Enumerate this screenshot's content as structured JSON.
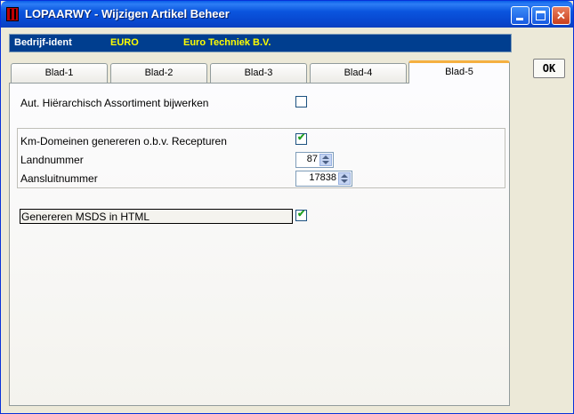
{
  "window": {
    "title": "LOPAARWY - Wijzigen Artikel Beheer"
  },
  "infobar": {
    "label": "Bedrijf-ident",
    "code": "EURO",
    "company": "Euro Techniek B.V."
  },
  "tabs": [
    {
      "label": "Blad-1",
      "active": false
    },
    {
      "label": "Blad-2",
      "active": false
    },
    {
      "label": "Blad-3",
      "active": false
    },
    {
      "label": "Blad-4",
      "active": false
    },
    {
      "label": "Blad-5",
      "active": true
    }
  ],
  "fields": {
    "aut_hierarchisch": {
      "label": "Aut. Hiërarchisch Assortiment bijwerken",
      "checked": false
    },
    "km_domeinen": {
      "label": "Km-Domeinen genereren o.b.v. Recepturen",
      "checked": true
    },
    "landnummer": {
      "label": "Landnummer",
      "value": "87"
    },
    "aansluitnummer": {
      "label": "Aansluitnummer",
      "value": "17838"
    },
    "msds_html": {
      "label": "Genereren MSDS in HTML",
      "checked": true
    }
  },
  "buttons": {
    "ok": "OK"
  },
  "icons": {
    "app": "app-icon",
    "minimize": "minimize-icon",
    "maximize": "maximize-icon",
    "close": "close-icon",
    "check": "checkmark-icon",
    "spin_up": "spin-up-icon",
    "spin_down": "spin-down-icon"
  },
  "colors": {
    "titlebar": "#0a55de",
    "infobar": "#003e8f",
    "highlight_text": "#ffff00",
    "check": "#21a121",
    "active_tab": "#f5b041"
  }
}
